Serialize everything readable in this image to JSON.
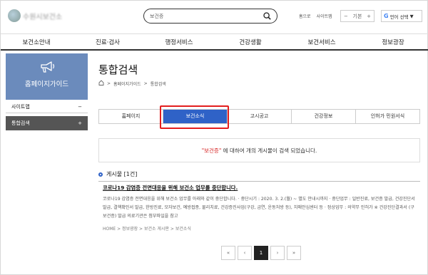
{
  "header": {
    "logo_text": "수원시보건소",
    "search_placeholder": "보건증",
    "utils": [
      "홈으로",
      "사이트맵"
    ],
    "font_size": {
      "minus": "−",
      "label": "기본",
      "plus": "+"
    },
    "lang": {
      "g": "G",
      "label": "언어 선택",
      "arrow": "▼"
    }
  },
  "gnb": [
    "보건소안내",
    "진료·검사",
    "행정서비스",
    "건강생활",
    "보건서비스",
    "정보광장"
  ],
  "sidebar": {
    "title": "홈페이지가이드",
    "items": [
      {
        "label": "사이트맵",
        "sign": "−"
      },
      {
        "label": "통합검색",
        "sign": "+"
      }
    ]
  },
  "main": {
    "title": "통합검색",
    "breadcrumb": [
      "홈페이지가이드",
      "통합검색"
    ],
    "tabs": [
      {
        "label": "홈페이지",
        "active": false
      },
      {
        "label": "보건소식",
        "active": true
      },
      {
        "label": "고시공고",
        "active": false
      },
      {
        "label": "건강정보",
        "active": false
      },
      {
        "label": "인허가 민원서식",
        "active": false
      }
    ],
    "result": {
      "keyword": "\"보건증\"",
      "text": " 에 대하여 개의 게시물이 검색 되었습니다."
    },
    "section_title": "게시물 [1건]",
    "post": {
      "title": "코로나19 감염증 전면대응을 위해 보건소 업무를 중단합니다.",
      "body": "코로나19 감염증 전면대응을 위해 보건소 업무를 아래와 같이 중단합니다. · 중단시기 : 2020. 3. 2.(월) ~ 별도 안내시까지 · 중단업무 : 일반진료, 보건증 발급, 건강진단서 발급, 결핵확인서 발급, 한방진료, 모자보건, 예방접종, 물리치료, 건강증진사업(구강, 금연, 운동처방 등), 치매안심센터 등 · 정상업무 : 의약무 인허가 ※ 건강진단결과서 (구 보건증) 발급 의료기관은 첨부파일을 참고",
      "path": "HOME > 정보광장 > 보건소 게시판 > 보건소식"
    },
    "pagination": [
      "«",
      "‹",
      "1",
      "›",
      "»"
    ],
    "current_page": "1"
  }
}
